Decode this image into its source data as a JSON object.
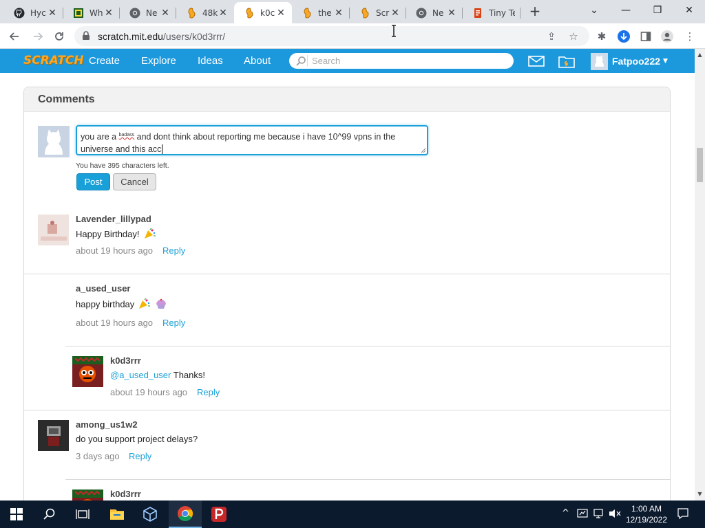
{
  "browser": {
    "tabs": [
      {
        "title": "Hyc",
        "favicon": "github-icon"
      },
      {
        "title": "Wh",
        "favicon": "webpage-icon"
      },
      {
        "title": "Ne",
        "favicon": "chrome-icon"
      },
      {
        "title": "48k",
        "favicon": "scratch-icon"
      },
      {
        "title": "k0c",
        "favicon": "scratch-icon",
        "active": true
      },
      {
        "title": "the",
        "favicon": "scratch-icon"
      },
      {
        "title": "Scr",
        "favicon": "scratch-icon"
      },
      {
        "title": "Ne",
        "favicon": "chrome-icon"
      },
      {
        "title": "Tiny Tex",
        "favicon": "document-icon"
      }
    ],
    "close_glyph": "✕",
    "new_tab_glyph": "+",
    "url_host": "scratch.mit.edu",
    "url_path": "/users/k0d3rrr/"
  },
  "scratch_nav": {
    "logo": "SCRATCH",
    "links": [
      "Create",
      "Explore",
      "Ideas",
      "About"
    ],
    "search_placeholder": "Search",
    "username": "Fatpoo222"
  },
  "comments_section": {
    "title": "Comments",
    "composer": {
      "text_parts": [
        "you are a ",
        "badass",
        " and dont think about reporting me because i have 10^99 vpns in the universe and this acc"
      ],
      "chars_left": "You have 395 characters left.",
      "post_label": "Post",
      "cancel_label": "Cancel"
    },
    "reply_label": "Reply",
    "comments": [
      {
        "user": "Lavender_lillypad",
        "text": "Happy Birthday!",
        "emoji": [
          "party-popper"
        ],
        "time": "about 19 hours ago"
      },
      {
        "user": "a_used_user",
        "text": "happy birthday",
        "emoji": [
          "party-popper",
          "cupcake"
        ],
        "time": "about 19 hours ago"
      },
      {
        "user": "k0d3rrr",
        "mention": "@a_used_user",
        "text": " Thanks!",
        "time": "about 19 hours ago",
        "is_reply": true
      },
      {
        "user": "among_us1w2",
        "text": "do you support project delays?",
        "time": "3 days ago"
      },
      {
        "user": "k0d3rrr",
        "is_reply": true
      }
    ]
  },
  "taskbar": {
    "time": "1:00 AM",
    "date": "12/19/2022",
    "apps": [
      "file-explorer",
      "virtualbox",
      "chrome",
      "psiphon"
    ]
  }
}
